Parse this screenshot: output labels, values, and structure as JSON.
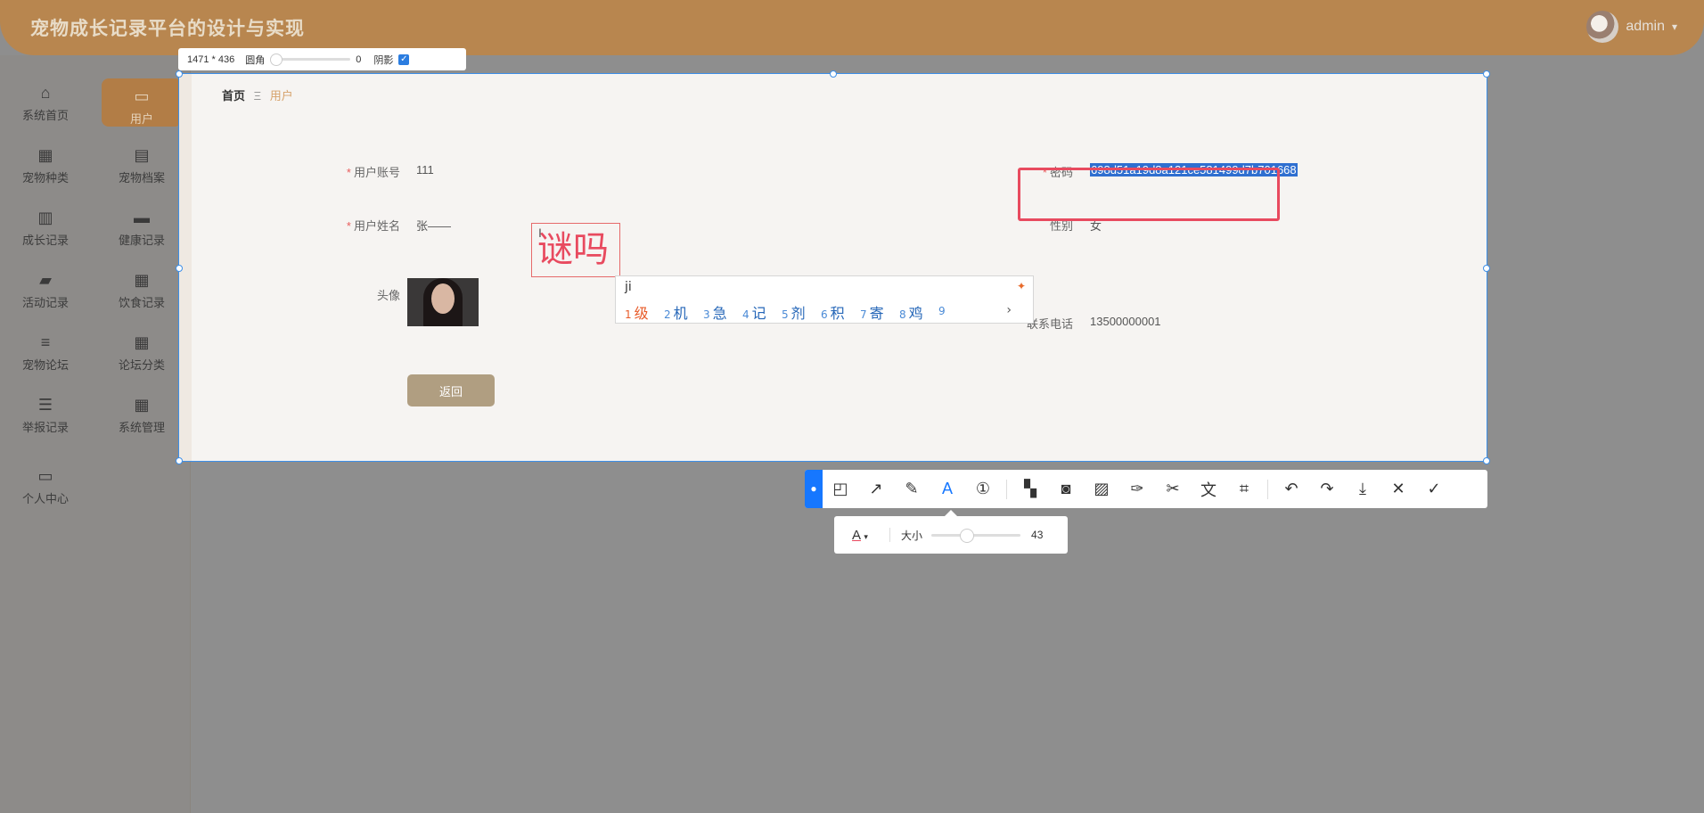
{
  "app": {
    "title": "宠物成长记录平台的设计与实现",
    "user": "admin"
  },
  "sidebar": {
    "items": [
      {
        "label": "系统首页",
        "icon": "home-icon",
        "glyph": "⌂"
      },
      {
        "label": "用户",
        "icon": "monitor-icon",
        "glyph": "▭"
      },
      {
        "label": "宠物种类",
        "icon": "grid-icon",
        "glyph": "▦"
      },
      {
        "label": "宠物档案",
        "icon": "chat-icon",
        "glyph": "▤"
      },
      {
        "label": "成长记录",
        "icon": "clipboard-icon",
        "glyph": "▥"
      },
      {
        "label": "健康记录",
        "icon": "briefcase-icon",
        "glyph": "▬"
      },
      {
        "label": "活动记录",
        "icon": "ticket-icon",
        "glyph": "▰"
      },
      {
        "label": "饮食记录",
        "icon": "apps-icon",
        "glyph": "▦"
      },
      {
        "label": "宠物论坛",
        "icon": "sliders-icon",
        "glyph": "≡"
      },
      {
        "label": "论坛分类",
        "icon": "apps-icon",
        "glyph": "▦"
      },
      {
        "label": "举报记录",
        "icon": "list-icon",
        "glyph": "☰"
      },
      {
        "label": "系统管理",
        "icon": "apps-icon",
        "glyph": "▦"
      },
      {
        "label": "个人中心",
        "icon": "wallet-icon",
        "glyph": "▭"
      }
    ]
  },
  "breadcrumb": {
    "home": "首页",
    "separator": "Ξ",
    "current": "用户"
  },
  "form": {
    "account_label": "用户账号",
    "account_value": "111",
    "name_label": "用户姓名",
    "name_value": "张——",
    "avatar_label": "头像",
    "password_label": "密码",
    "password_value": "698d51a19d8a121ce581499d7b701668",
    "gender_label": "性别",
    "gender_value": "女",
    "phone_label": "联系电话",
    "phone_value": "13500000001",
    "back_button": "返回"
  },
  "annotation": {
    "text": "谜吗"
  },
  "ime": {
    "input": "ji",
    "candidates": [
      {
        "num": "1",
        "ch": "级"
      },
      {
        "num": "2",
        "ch": "机"
      },
      {
        "num": "3",
        "ch": "急"
      },
      {
        "num": "4",
        "ch": "记"
      },
      {
        "num": "5",
        "ch": "剂"
      },
      {
        "num": "6",
        "ch": "积"
      },
      {
        "num": "7",
        "ch": "寄"
      },
      {
        "num": "8",
        "ch": "鸡"
      },
      {
        "num": "9",
        "ch": ""
      }
    ],
    "next": "›"
  },
  "capture": {
    "size_text": "1471 * 436",
    "radius_label": "圆角",
    "radius_value": "0",
    "shadow_label": "阴影",
    "shadow_checked": true,
    "font_size_label": "大小",
    "font_size_value": "43"
  },
  "toolbar": {
    "tools": [
      {
        "name": "shape-tool-icon",
        "glyph": "◰"
      },
      {
        "name": "arrow-tool-icon",
        "glyph": "↗"
      },
      {
        "name": "pen-tool-icon",
        "glyph": "✎"
      },
      {
        "name": "text-tool-icon",
        "glyph": "A",
        "active": true
      },
      {
        "name": "number-tool-icon",
        "glyph": "①"
      },
      {
        "name": "sep"
      },
      {
        "name": "mosaic-tool-icon",
        "glyph": "▚"
      },
      {
        "name": "blur-tool-icon",
        "glyph": "◙"
      },
      {
        "name": "hatch-tool-icon",
        "glyph": "▨"
      },
      {
        "name": "pin-tool-icon",
        "glyph": "✑"
      },
      {
        "name": "cut-tool-icon",
        "glyph": "✂"
      },
      {
        "name": "translate-tool-icon",
        "glyph": "文"
      },
      {
        "name": "ocr-tool-icon",
        "glyph": "⌗"
      },
      {
        "name": "sep"
      },
      {
        "name": "undo-icon",
        "glyph": "↶"
      },
      {
        "name": "redo-icon",
        "glyph": "↷"
      },
      {
        "name": "download-icon",
        "glyph": "⤓"
      },
      {
        "name": "close-icon",
        "glyph": "✕"
      },
      {
        "name": "confirm-icon",
        "glyph": "✓"
      }
    ]
  },
  "colors": {
    "accent": "#b8864f",
    "active_menu": "#b27d46",
    "annotation": "#e84a5f",
    "selection": "#3d8fe8",
    "toolbar_active": "#1677ff"
  }
}
